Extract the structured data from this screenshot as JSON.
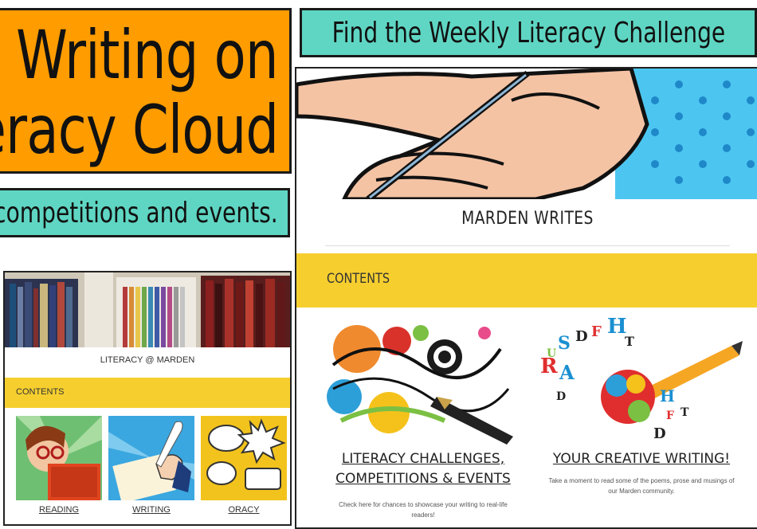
{
  "left_banner": {
    "line1": "e Writing on",
    "line2": "eracy Cloud"
  },
  "left_subbanner": "any competitions and events.",
  "right_banner": "Find the Weekly Literacy Challenge",
  "small_site": {
    "title": "LITERACY @ MARDEN",
    "contents_label": "CONTENTS",
    "tiles": [
      {
        "label": "READING",
        "icon": "woman-reading-book"
      },
      {
        "label": "WRITING",
        "icon": "hand-writing-quill"
      },
      {
        "label": "ORACY",
        "icon": "speech-bubbles"
      }
    ]
  },
  "main_site": {
    "hero_icon": "hand-holding-pen",
    "title": "MARDEN WRITES",
    "contents_label": "CONTENTS",
    "cards": [
      {
        "title_line1": "LITERACY CHALLENGES,",
        "title_line2": "COMPETITIONS & EVENTS",
        "description": "Check here for chances to showcase your writing to real-life readers!",
        "icon": "fountain-pen-swirl-art"
      },
      {
        "title_line1": "YOUR CREATIVE WRITING!",
        "title_line2": "",
        "description": "Take a moment to read some of the poems, prose and musings of our Marden community.",
        "icon": "fist-with-pencil-letters"
      }
    ]
  }
}
